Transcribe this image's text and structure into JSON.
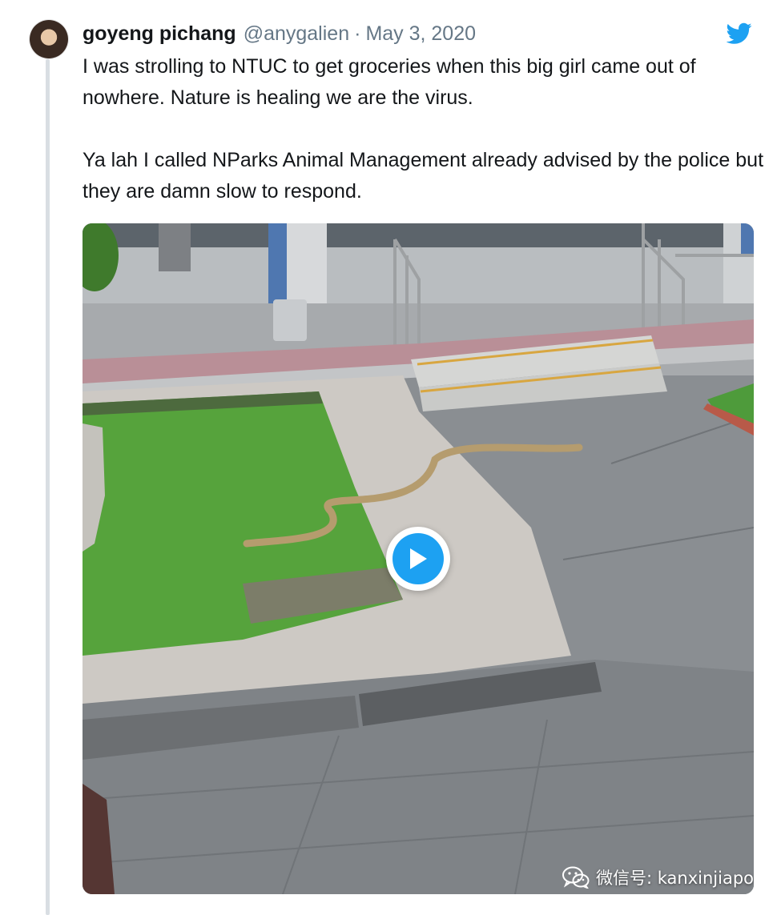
{
  "tweet": {
    "author_name": "goyeng pichang",
    "author_handle": "@anygalien",
    "separator": "·",
    "date": "May 3, 2020",
    "paragraphs": [
      "I was strolling to NTUC to get groceries when this big girl came out of nowhere. Nature is healing we are the virus.",
      "Ya lah I called NParks Animal Management already advised by the police but they are damn slow to respond."
    ]
  },
  "media": {
    "type": "video",
    "play_icon": "play-icon",
    "accent_color": "#1da1f2"
  },
  "watermark": {
    "text": "微信号: kanxinjiapo",
    "icon": "wechat-icon"
  },
  "brand_icon": "twitter-bird-icon",
  "colors": {
    "text": "#14171a",
    "muted": "#657786",
    "twitter_blue": "#1da1f2",
    "thread_line": "#d9dee3"
  }
}
